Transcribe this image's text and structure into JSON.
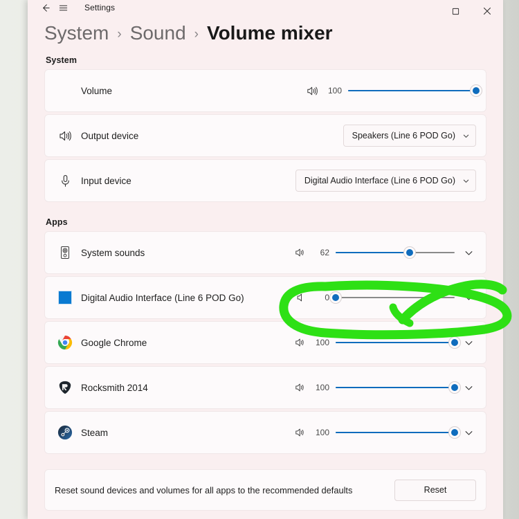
{
  "window": {
    "app_title": "Settings",
    "back_icon": "arrow-left-icon",
    "menu_icon": "hamburger-icon",
    "controls": [
      {
        "name": "maximize-button",
        "glyph": "maximize-icon"
      },
      {
        "name": "close-button",
        "glyph": "close-icon"
      }
    ]
  },
  "breadcrumb": {
    "segments": [
      "System",
      "Sound",
      "Volume mixer"
    ],
    "separator": "›"
  },
  "system_section": {
    "label": "System",
    "volume_row": {
      "label": "Volume",
      "speaker_icon": "speaker-loud-icon",
      "value": "100",
      "percent": 100
    },
    "output_row": {
      "label": "Output device",
      "icon": "speaker-loud-icon",
      "selected": "Speakers (Line 6 POD Go)",
      "chevron": "chevron-down-icon"
    },
    "input_row": {
      "label": "Input device",
      "icon": "microphone-icon",
      "selected": "Digital Audio Interface (Line 6 POD Go)",
      "chevron": "chevron-down-icon"
    }
  },
  "apps_section": {
    "label": "Apps",
    "rows": [
      {
        "name": "system-sounds",
        "label": "System sounds",
        "icon": "speaker-cabinet-icon",
        "speaker_icon": "speaker-loud-icon",
        "value": "62",
        "percent": 62,
        "muted": false,
        "chevron": "chevron-down-icon"
      },
      {
        "name": "digital-audio-interface",
        "label": "Digital Audio Interface (Line 6 POD Go)",
        "icon": "blue-square-icon",
        "speaker_icon": "speaker-muted-icon",
        "value": "0",
        "percent": 0,
        "muted": true,
        "chevron": "chevron-down-icon"
      },
      {
        "name": "google-chrome",
        "label": "Google Chrome",
        "icon": "chrome-icon",
        "speaker_icon": "speaker-loud-icon",
        "value": "100",
        "percent": 100,
        "muted": false,
        "chevron": "chevron-down-icon"
      },
      {
        "name": "rocksmith-2014",
        "label": "Rocksmith 2014",
        "icon": "rocksmith-pick-icon",
        "speaker_icon": "speaker-loud-icon",
        "value": "100",
        "percent": 100,
        "muted": false,
        "chevron": "chevron-down-icon"
      },
      {
        "name": "steam",
        "label": "Steam",
        "icon": "steam-icon",
        "speaker_icon": "speaker-loud-icon",
        "value": "100",
        "percent": 100,
        "muted": false,
        "chevron": "chevron-down-icon"
      }
    ]
  },
  "reset_section": {
    "description": "Reset sound devices and volumes for all apps to the recommended defaults",
    "button_label": "Reset"
  },
  "annotation": {
    "type": "hand-drawn-highlight",
    "color": "#2ee015",
    "target": "digital-audio-interface-slider-row",
    "shape": "ellipse-with-crossing-stroke"
  },
  "colors": {
    "page_background": "#faeff0",
    "card_background": "#fdfafb",
    "accent_blue": "#0f6cbd",
    "rail_gray": "#8a8a8a",
    "annotation_green": "#2ee015"
  }
}
